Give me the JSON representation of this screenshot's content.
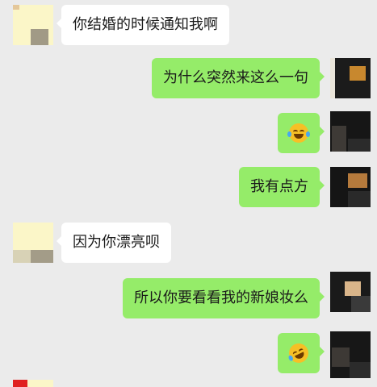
{
  "messages": [
    {
      "side": "in",
      "text": "你结婚的时候通知我啊"
    },
    {
      "side": "out",
      "text": "为什么突然来这么一句"
    },
    {
      "side": "out",
      "emoji": "tears-of-joy-emoji"
    },
    {
      "side": "out",
      "text": "我有点方"
    },
    {
      "side": "in",
      "text": "因为你漂亮呗"
    },
    {
      "side": "out",
      "text": "所以你要看看我的新娘妆么"
    },
    {
      "side": "out",
      "emoji": "rolling-laughing-emoji"
    }
  ],
  "colors": {
    "background": "#ebebeb",
    "incoming_bubble": "#ffffff",
    "outgoing_bubble": "#95ec69"
  }
}
